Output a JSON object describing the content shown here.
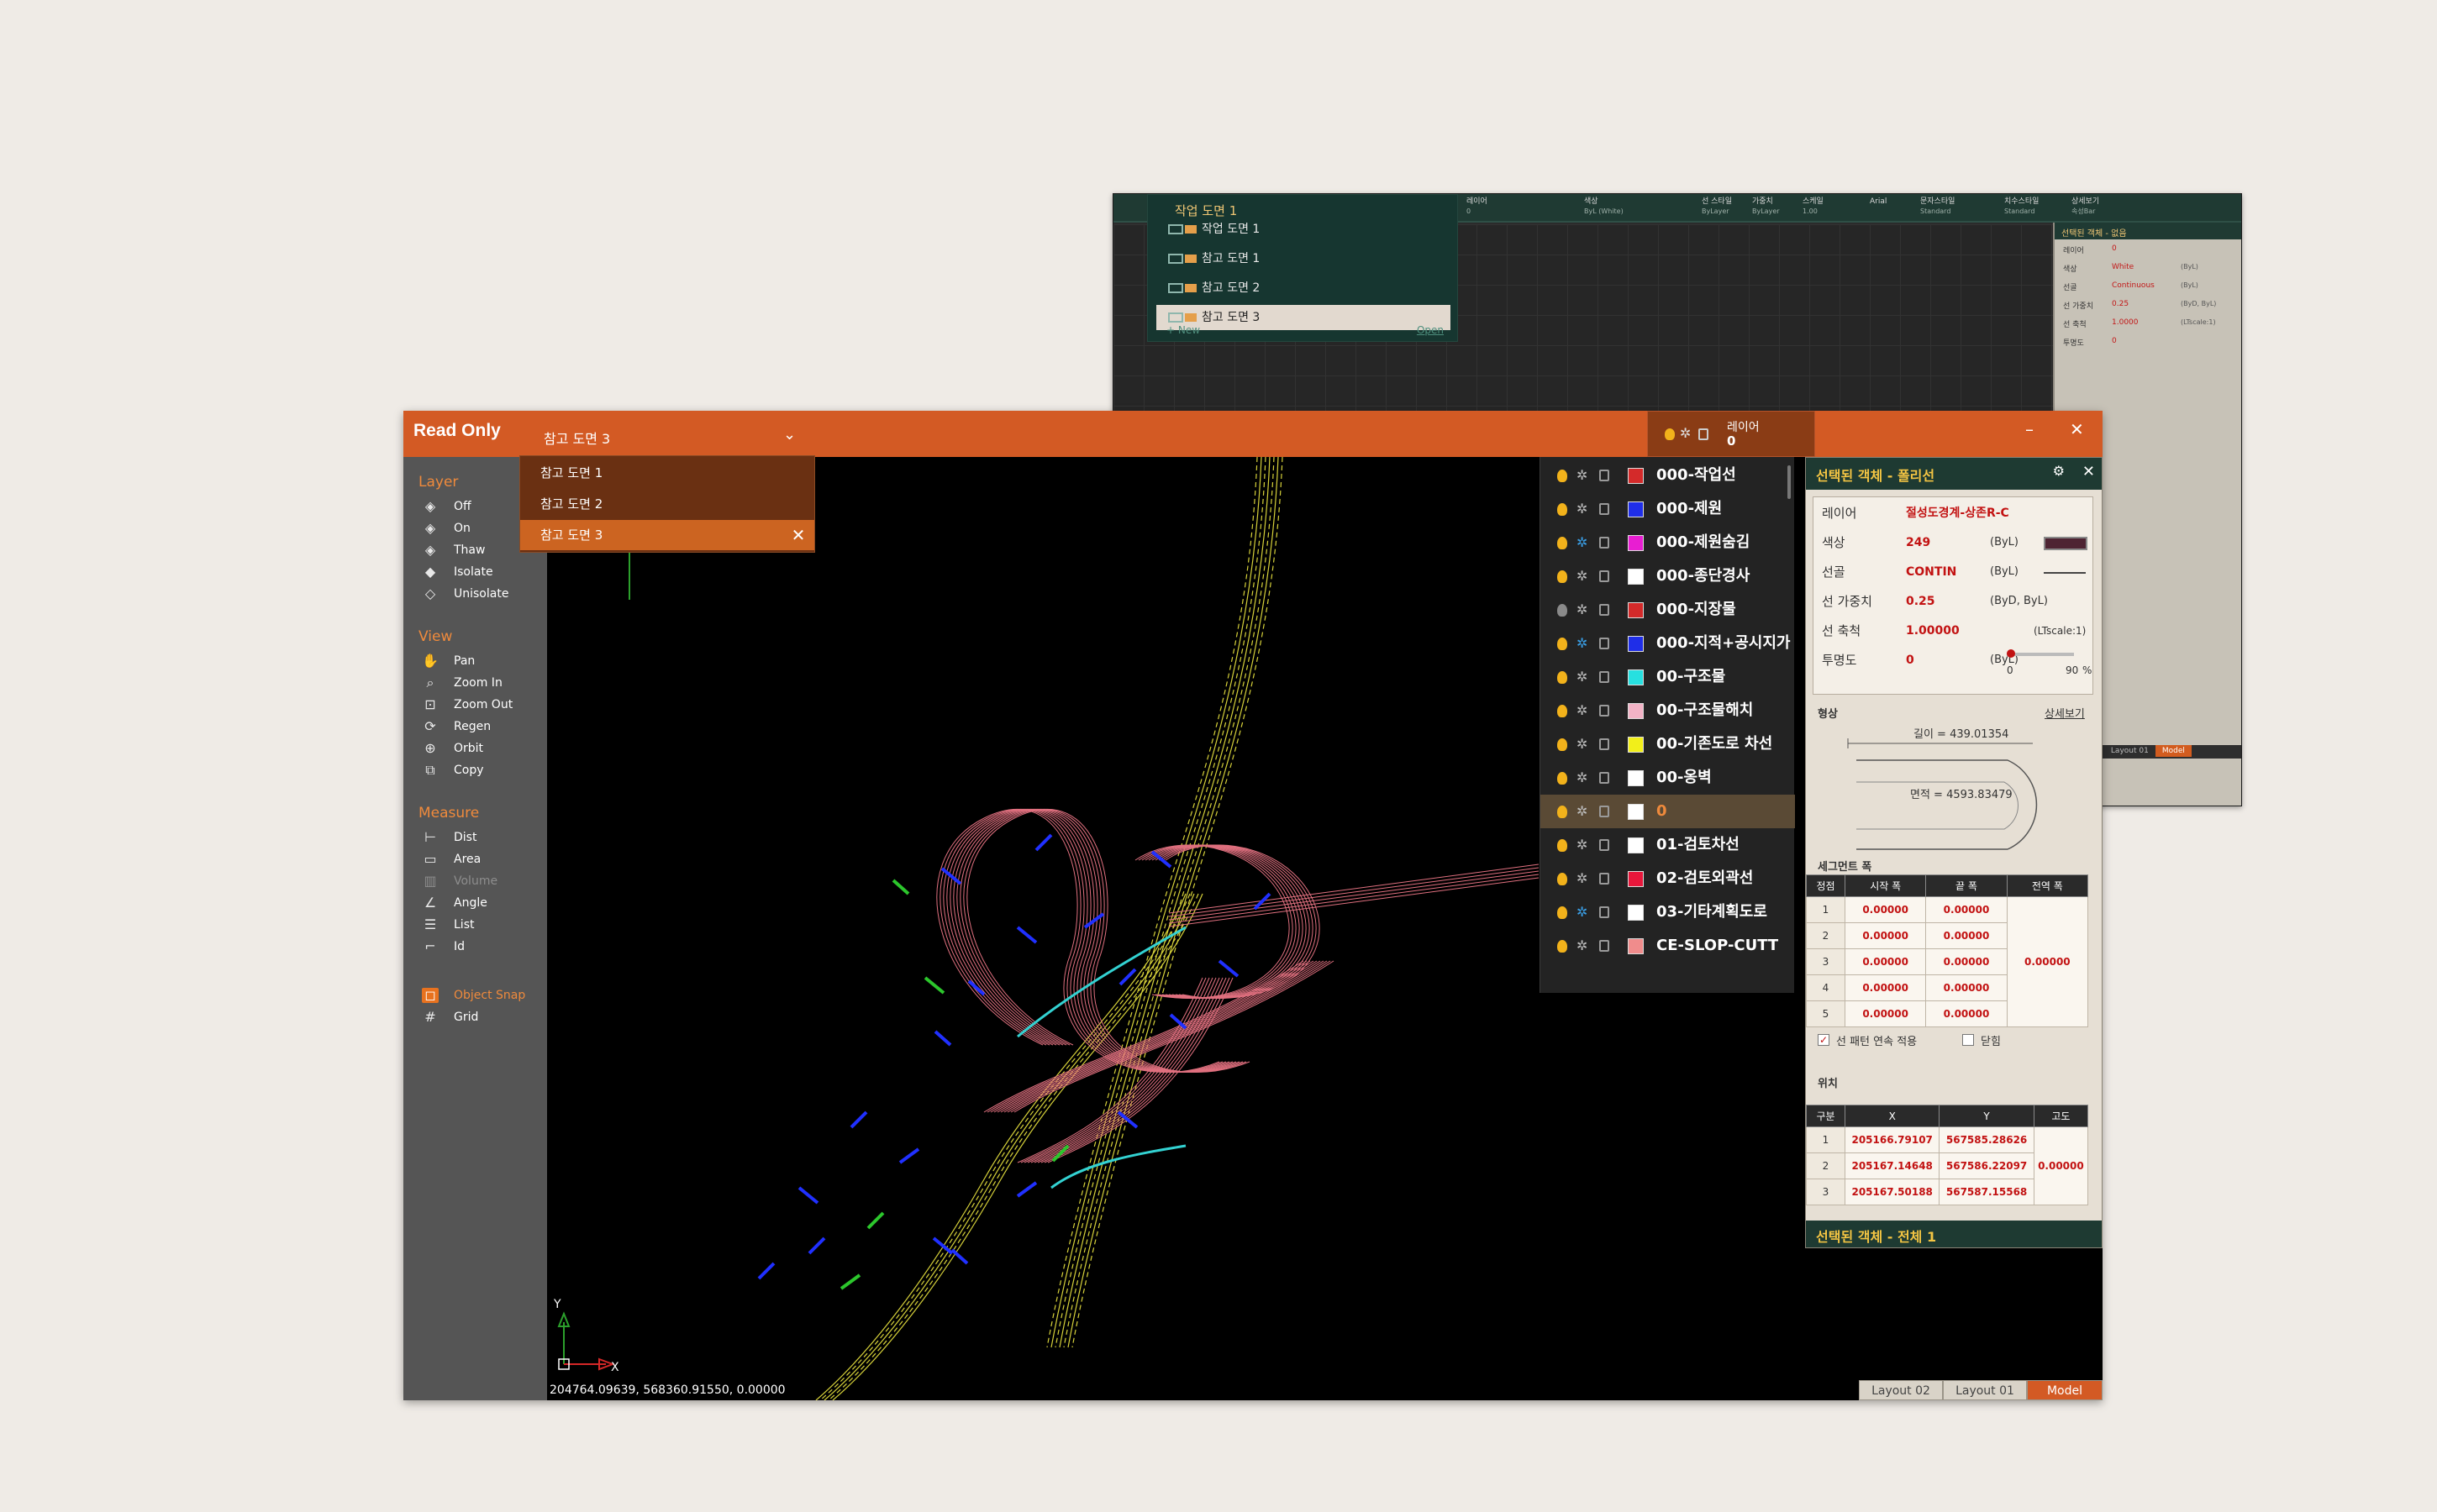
{
  "back_window": {
    "ribbon": [
      {
        "label": "레이어",
        "sub": "0"
      },
      {
        "label": "색상",
        "sub": "ByL (White)"
      },
      {
        "label": "선 스타일",
        "sub": "ByLayer"
      },
      {
        "label": "가중치",
        "sub": "ByLayer"
      },
      {
        "label": "스케일",
        "sub": "1.00"
      },
      {
        "label": "Arial",
        "sub": ""
      },
      {
        "label": "문자스타일",
        "sub": "Standard"
      },
      {
        "label": "치수스타일",
        "sub": "Standard"
      },
      {
        "label": "상세보기",
        "sub": "속성Bar"
      }
    ],
    "drawing_dropdown": {
      "header": "작업 도면 1",
      "items": [
        {
          "label": "작업 도면 1",
          "selected": false
        },
        {
          "label": "참고 도면 1",
          "selected": false
        },
        {
          "label": "참고 도면 2",
          "selected": false
        },
        {
          "label": "참고 도면 3",
          "selected": true
        }
      ],
      "new_label": "+ New",
      "open_label": "Open"
    },
    "props_title": "선택된 객체 - 없음",
    "props": [
      {
        "label": "레이어",
        "value": "0",
        "by": ""
      },
      {
        "label": "색상",
        "value": "White",
        "by": "(ByL)"
      },
      {
        "label": "선골",
        "value": "Continuous",
        "by": "(ByL)"
      },
      {
        "label": "선 가중치",
        "value": "0.25",
        "by": "(ByD, ByL)"
      },
      {
        "label": "선 축척",
        "value": "1.0000",
        "by": "(LTscale:1)"
      },
      {
        "label": "투명도",
        "value": "0",
        "by": ""
      }
    ],
    "tabs": [
      "Layout 02",
      "Layout 01",
      "Model"
    ]
  },
  "main_window": {
    "title_badge": "Read Only",
    "current_drawing": "참고 도면 3",
    "window_controls": {
      "minimize": "–",
      "close": "✕"
    },
    "layer_indicator": {
      "label": "레이어",
      "value": "0"
    },
    "drawing_dropdown": {
      "items": [
        {
          "label": "참고 도면 1",
          "selected": false
        },
        {
          "label": "참고 도면 2",
          "selected": false
        },
        {
          "label": "참고 도면 3",
          "selected": true
        }
      ],
      "close_icon": "✕"
    },
    "sidebar": {
      "sections": [
        {
          "title": "Layer",
          "items": [
            {
              "label": "Off",
              "icon": "layer-off-icon",
              "enabled": true
            },
            {
              "label": "On",
              "icon": "layer-on-icon",
              "enabled": true
            },
            {
              "label": "Thaw",
              "icon": "layer-thaw-icon",
              "enabled": true
            },
            {
              "label": "Isolate",
              "icon": "layer-isolate-icon",
              "enabled": true
            },
            {
              "label": "Unisolate",
              "icon": "layer-unisolate-icon",
              "enabled": true
            }
          ]
        },
        {
          "title": "View",
          "items": [
            {
              "label": "Pan",
              "icon": "hand-icon",
              "enabled": true
            },
            {
              "label": "Zoom In",
              "icon": "zoom-in-icon",
              "enabled": true
            },
            {
              "label": "Zoom Out",
              "icon": "zoom-out-icon",
              "enabled": true
            },
            {
              "label": "Regen",
              "icon": "regen-icon",
              "enabled": true
            },
            {
              "label": "Orbit",
              "icon": "orbit-icon",
              "enabled": true
            },
            {
              "label": "Copy",
              "icon": "copy-icon",
              "enabled": true
            }
          ]
        },
        {
          "title": "Measure",
          "items": [
            {
              "label": "Dist",
              "icon": "dist-icon",
              "enabled": true
            },
            {
              "label": "Area",
              "icon": "area-icon",
              "enabled": true
            },
            {
              "label": "Volume",
              "icon": "volume-icon",
              "enabled": false
            },
            {
              "label": "Angle",
              "icon": "angle-icon",
              "enabled": true
            },
            {
              "label": "List",
              "icon": "list-icon",
              "enabled": true
            },
            {
              "label": "Id",
              "icon": "id-icon",
              "enabled": true
            }
          ]
        }
      ],
      "toggles": [
        {
          "label": "Object Snap",
          "icon": "object-snap-icon",
          "active": true
        },
        {
          "label": "Grid",
          "icon": "grid-icon",
          "active": false
        }
      ]
    },
    "layers": [
      {
        "name": "000-작업선",
        "color": "#d42a2a",
        "on": true,
        "freeze_blue": false,
        "current": false
      },
      {
        "name": "000-제원",
        "color": "#1f2ee8",
        "on": true,
        "freeze_blue": false,
        "current": false
      },
      {
        "name": "000-제원숨김",
        "color": "#e81ed2",
        "on": true,
        "freeze_blue": true,
        "current": false
      },
      {
        "name": "000-종단경사",
        "color": "#ffffff",
        "on": true,
        "freeze_blue": false,
        "current": false
      },
      {
        "name": "000-지장물",
        "color": "#d42a2a",
        "on": false,
        "freeze_blue": false,
        "current": false
      },
      {
        "name": "000-지적+공시지가",
        "color": "#1f2ee8",
        "on": true,
        "freeze_blue": true,
        "current": false
      },
      {
        "name": "00-구조물",
        "color": "#27e0e0",
        "on": true,
        "freeze_blue": false,
        "current": false
      },
      {
        "name": "00-구조물해치",
        "color": "#f2b3c6",
        "on": true,
        "freeze_blue": false,
        "current": false
      },
      {
        "name": "00-기존도로 차선",
        "color": "#f2ef1a",
        "on": true,
        "freeze_blue": false,
        "current": false
      },
      {
        "name": "00-옹벽",
        "color": "#ffffff",
        "on": true,
        "freeze_blue": false,
        "current": false
      },
      {
        "name": "0",
        "color": "#ffffff",
        "on": true,
        "freeze_blue": false,
        "current": true
      },
      {
        "name": "01-검토차선",
        "color": "#ffffff",
        "on": true,
        "freeze_blue": false,
        "current": false
      },
      {
        "name": "02-검토외곽선",
        "color": "#e8173b",
        "on": true,
        "freeze_blue": false,
        "current": false
      },
      {
        "name": "03-기타계획도로",
        "color": "#ffffff",
        "on": true,
        "freeze_blue": true,
        "current": false
      },
      {
        "name": "CE-SLOP-CUTT",
        "color": "#f08c8c",
        "on": true,
        "freeze_blue": false,
        "current": false
      }
    ],
    "properties": {
      "title": "선택된 객체 - 폴리선",
      "rows": [
        {
          "label": "레이어",
          "value": "절성도경계-상존R-C",
          "by": "",
          "extra": ""
        },
        {
          "label": "색상",
          "value": "249",
          "by": "(ByL)",
          "extra": ""
        },
        {
          "label": "선골",
          "value": "CONTIN",
          "by": "(ByL)",
          "extra": ""
        },
        {
          "label": "선 가중치",
          "value": "0.25",
          "by": "(ByD, ByL)",
          "extra": ""
        },
        {
          "label": "선 축척",
          "value": "1.00000",
          "by": "",
          "extra": "(LTscale:1)"
        },
        {
          "label": "투명도",
          "value": "0",
          "by": "(ByL)",
          "extra": ""
        }
      ],
      "transparency": {
        "min": "0",
        "max": "90",
        "unit": "%",
        "level": 0
      },
      "swatch_color": "#4e2433",
      "shape_title": "형상",
      "detail_link": "상세보기",
      "length_label": "길이 = 439.01354",
      "area_label": "면적 = 4593.83479",
      "segment_title": "세그먼트 폭",
      "segment_headers": [
        "정점",
        "시작 폭",
        "끝 폭",
        "전역 폭"
      ],
      "segment_rows": [
        {
          "idx": "1",
          "start": "0.00000",
          "end": "0.00000"
        },
        {
          "idx": "2",
          "start": "0.00000",
          "end": "0.00000"
        },
        {
          "idx": "3",
          "start": "0.00000",
          "end": "0.00000"
        },
        {
          "idx": "4",
          "start": "0.00000",
          "end": "0.00000"
        },
        {
          "idx": "5",
          "start": "0.00000",
          "end": "0.00000"
        }
      ],
      "global_width": "0.00000",
      "linetype_continuous_label": "선 패턴 연속 적용",
      "linetype_continuous_checked": true,
      "closed_label": "닫힘",
      "closed_checked": false,
      "position_title": "위치",
      "position_headers": [
        "구분",
        "X",
        "Y",
        "고도"
      ],
      "position_rows": [
        {
          "idx": "1",
          "x": "205166.79107",
          "y": "567585.28626"
        },
        {
          "idx": "2",
          "x": "205167.14648",
          "y": "567586.22097"
        },
        {
          "idx": "3",
          "x": "205167.50188",
          "y": "567587.15568"
        }
      ],
      "elevation": "0.00000",
      "footer": "선택된 객체 - 전체 1"
    },
    "coords": "204764.09639, 568360.91550, 0.00000",
    "axis": {
      "x": "X",
      "y": "Y"
    },
    "tabs": [
      {
        "label": "Layout 02",
        "active": false
      },
      {
        "label": "Layout 01",
        "active": false
      },
      {
        "label": "Model",
        "active": true
      }
    ]
  }
}
